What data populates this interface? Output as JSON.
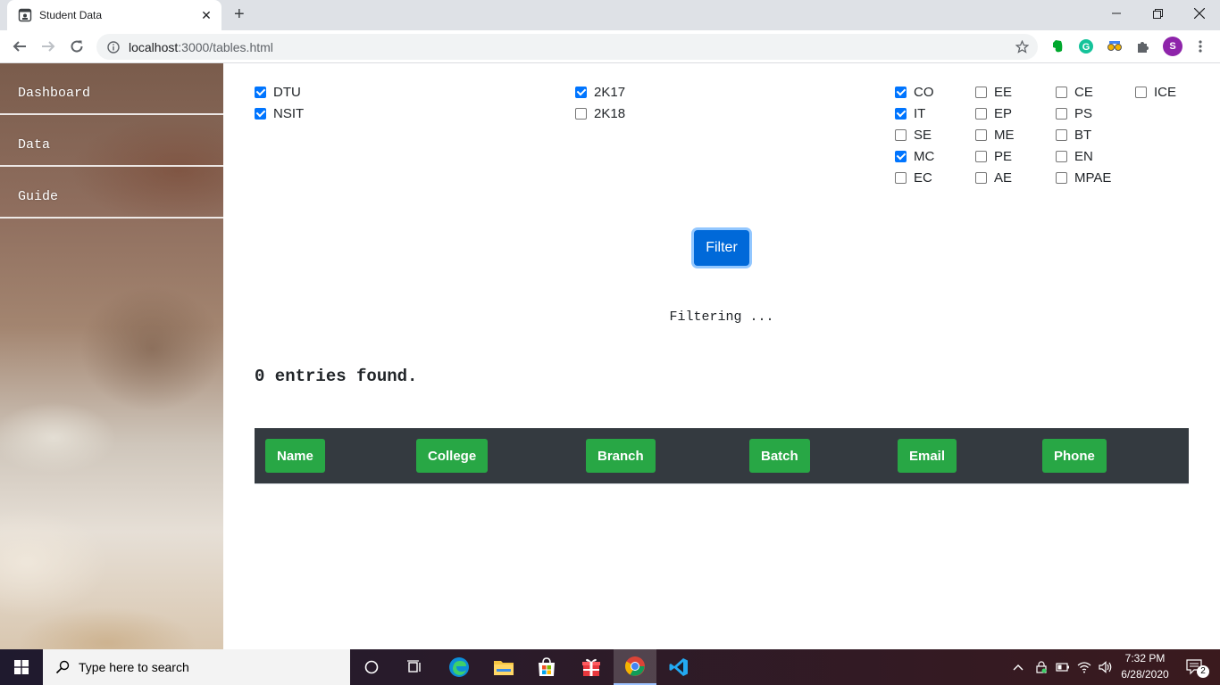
{
  "browser": {
    "tab_title": "Student Data",
    "url_host": "localhost",
    "url_rest": ":3000/tables.html",
    "profile_initial": "S"
  },
  "sidebar": {
    "items": [
      {
        "label": "Dashboard"
      },
      {
        "label": "Data"
      },
      {
        "label": "Guide"
      }
    ]
  },
  "filters": {
    "colleges": [
      {
        "label": "DTU",
        "checked": true
      },
      {
        "label": "NSIT",
        "checked": true
      }
    ],
    "batches": [
      {
        "label": "2K17",
        "checked": true
      },
      {
        "label": "2K18",
        "checked": false
      }
    ],
    "branches": [
      [
        {
          "label": "CO",
          "checked": true
        },
        {
          "label": "IT",
          "checked": true
        },
        {
          "label": "SE",
          "checked": false
        },
        {
          "label": "MC",
          "checked": true
        },
        {
          "label": "EC",
          "checked": false
        }
      ],
      [
        {
          "label": "EE",
          "checked": false
        },
        {
          "label": "EP",
          "checked": false
        },
        {
          "label": "ME",
          "checked": false
        },
        {
          "label": "PE",
          "checked": false
        },
        {
          "label": "AE",
          "checked": false
        }
      ],
      [
        {
          "label": "CE",
          "checked": false
        },
        {
          "label": "PS",
          "checked": false
        },
        {
          "label": "BT",
          "checked": false
        },
        {
          "label": "EN",
          "checked": false
        },
        {
          "label": "MPAE",
          "checked": false
        }
      ],
      [
        {
          "label": "ICE",
          "checked": false
        }
      ]
    ],
    "filter_button": "Filter"
  },
  "status": {
    "filtering": "Filtering ...",
    "entries": "0 entries found."
  },
  "table": {
    "headers": [
      "Name",
      "College",
      "Branch",
      "Batch",
      "Email",
      "Phone"
    ]
  },
  "taskbar": {
    "search_placeholder": "Type here to search",
    "time": "7:32 PM",
    "date": "6/28/2020",
    "notification_count": "2"
  },
  "colors": {
    "primary": "#0069d9",
    "success": "#28a745",
    "table_header": "#343a40",
    "checkbox": "#0075ff"
  }
}
